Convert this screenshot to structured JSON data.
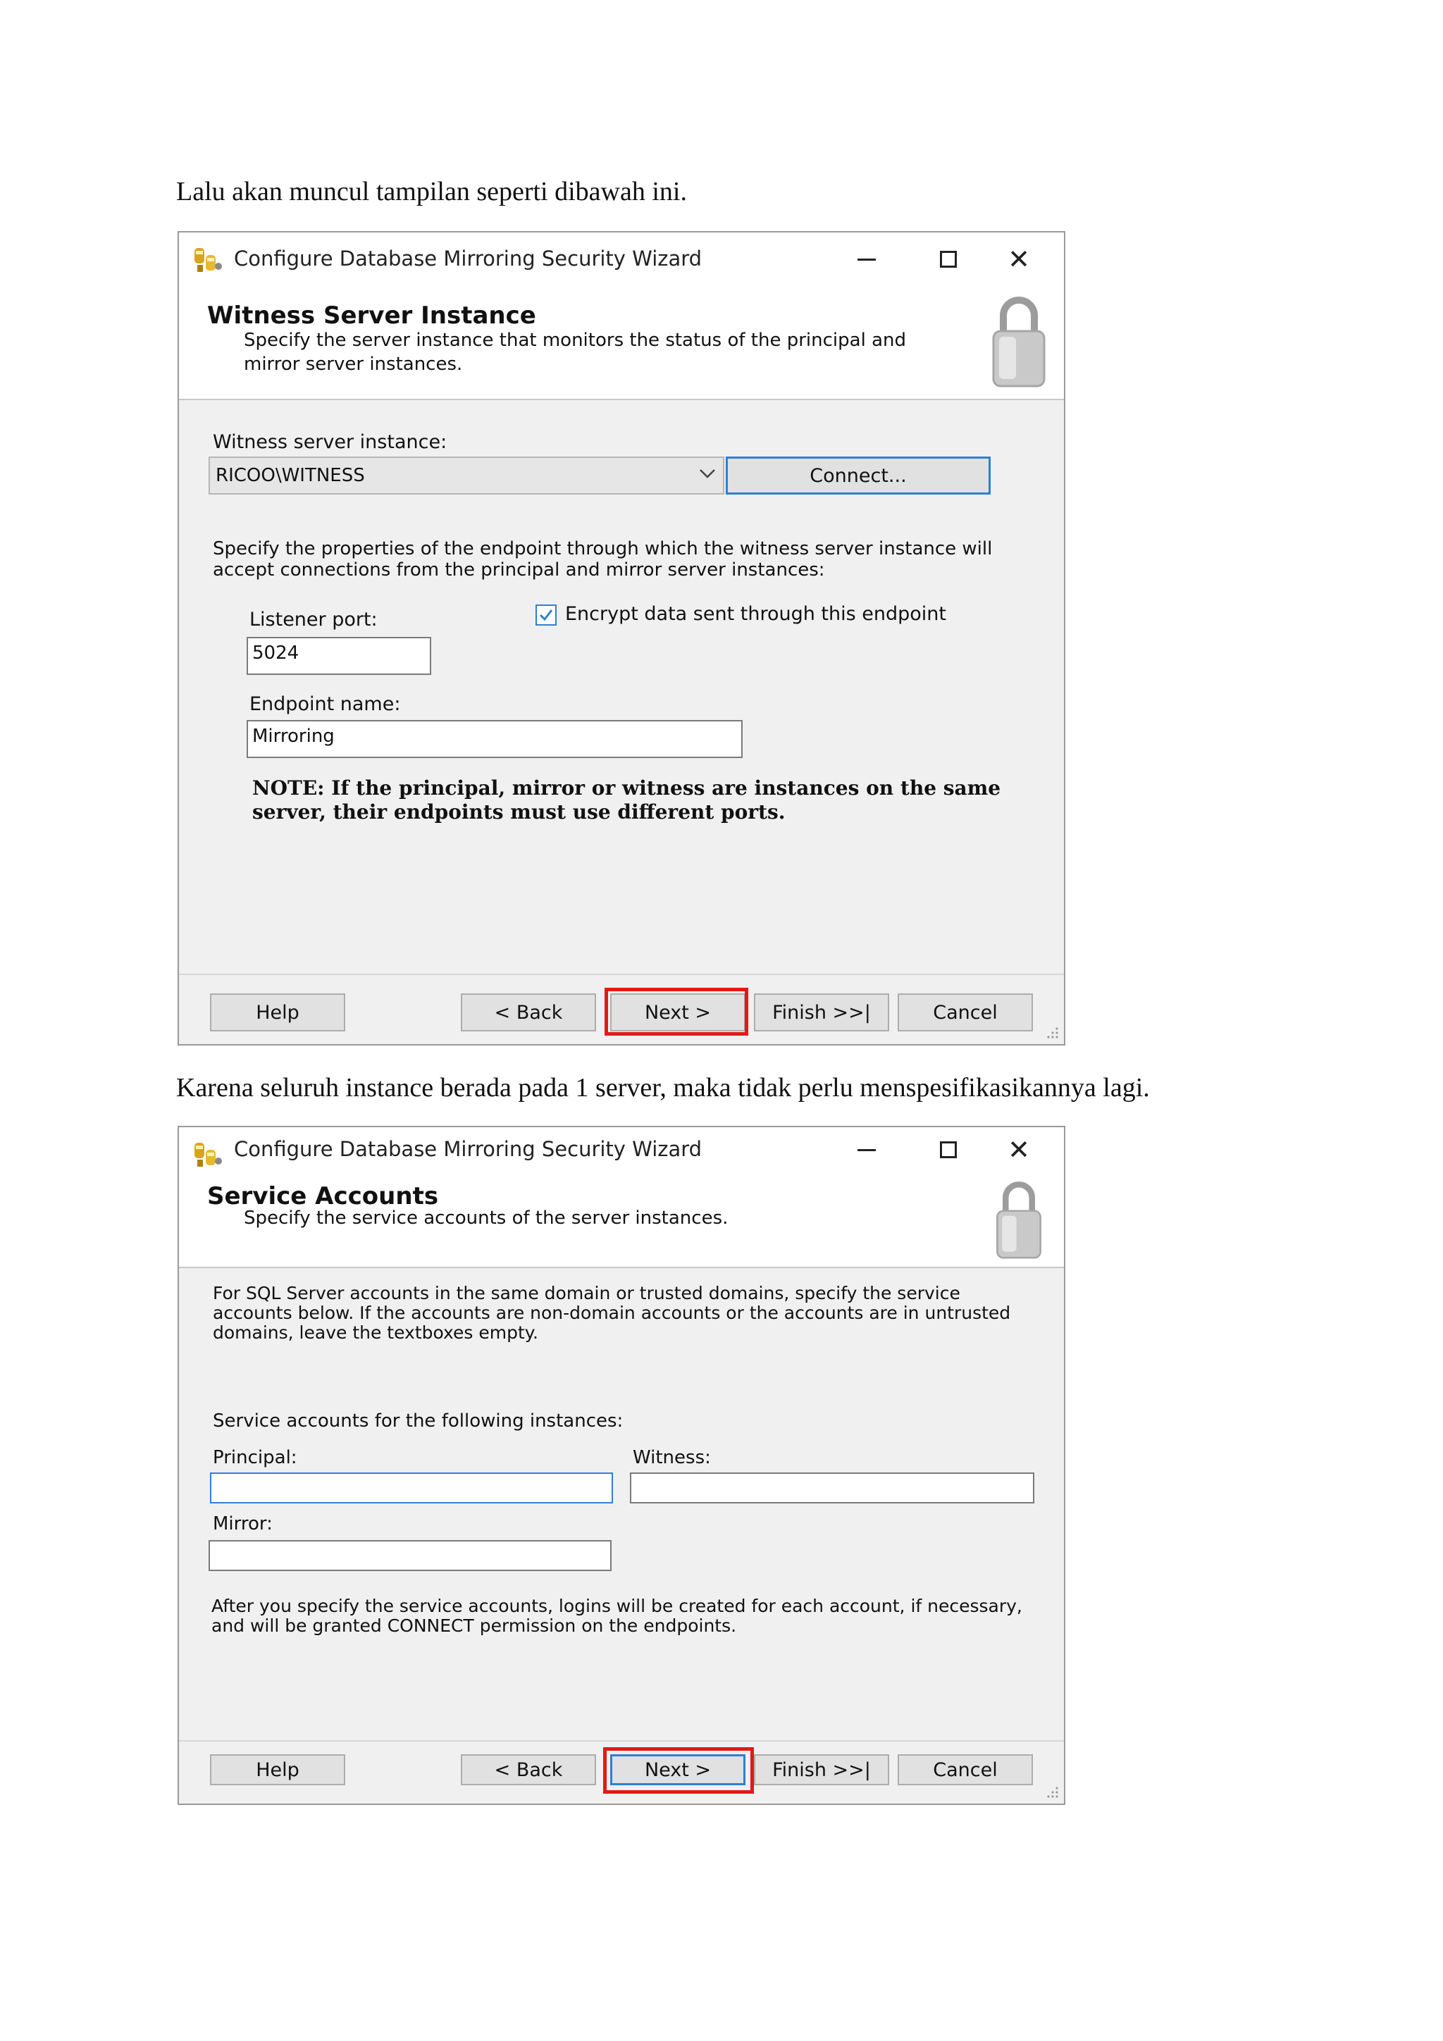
{
  "paragraphs": {
    "intro": "Lalu akan muncul tampilan seperti dibawah ini.",
    "between": "Karena seluruh instance berada pada 1 server, maka tidak perlu menspesifikasikannya lagi."
  },
  "dialog1": {
    "title": "Configure Database Mirroring Security Wizard",
    "page_title": "Witness Server Instance",
    "page_desc": "Specify the server instance that monitors the status of the principal and mirror server instances.",
    "witness_label": "Witness server instance:",
    "witness_value": "RICOO\\WITNESS",
    "connect_label": "Connect...",
    "endpoint_intro": "Specify the properties of the endpoint through which the witness server instance will accept connections from the principal and mirror server instances:",
    "listener_label": "Listener port:",
    "listener_value": "5024",
    "encrypt_label": "Encrypt data sent through this endpoint",
    "encrypt_checked": true,
    "endpoint_label": "Endpoint name:",
    "endpoint_value": "Mirroring",
    "note": "NOTE: If the principal, mirror or witness are instances on the same server, their endpoints must use different ports.",
    "buttons": {
      "help": "Help",
      "back": "< Back",
      "next": "Next >",
      "finish": "Finish >>|",
      "cancel": "Cancel"
    }
  },
  "dialog2": {
    "title": "Configure Database Mirroring Security Wizard",
    "page_title": "Service Accounts",
    "page_desc": "Specify the service accounts of the server instances.",
    "intro": "For SQL Server accounts in the same domain or trusted domains, specify the service accounts below. If the accounts are non-domain accounts or the accounts are in untrusted domains, leave the textboxes empty.",
    "accounts_label": "Service accounts for the following instances:",
    "principal_label": "Principal:",
    "principal_value": "",
    "witness_label": "Witness:",
    "witness_value": "",
    "mirror_label": "Mirror:",
    "mirror_value": "",
    "after_text": "After you specify the service accounts, logins will be created for each account, if necessary, and will be granted CONNECT permission on the endpoints.",
    "buttons": {
      "help": "Help",
      "back": "< Back",
      "next": "Next >",
      "finish": "Finish >>|",
      "cancel": "Cancel"
    }
  },
  "colors": {
    "highlight": "#e0191b",
    "focus_blue": "#2f7fd3"
  }
}
